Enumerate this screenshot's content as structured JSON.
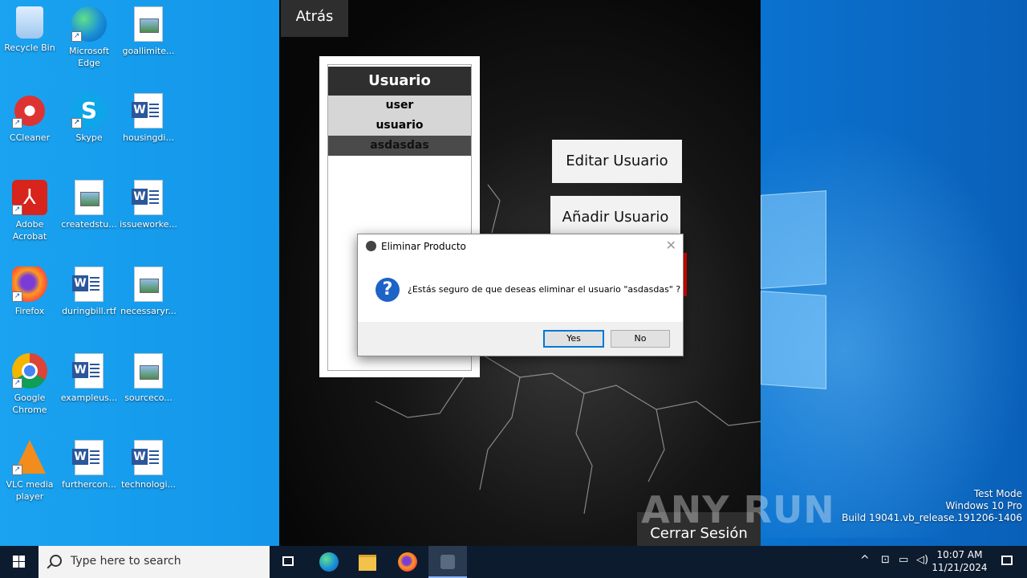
{
  "desktop": {
    "icons": [
      {
        "label": "Recycle Bin"
      },
      {
        "label": "Microsoft Edge"
      },
      {
        "label": "goallimite..."
      },
      {
        "label": "CCleaner"
      },
      {
        "label": "Skype"
      },
      {
        "label": "housingdi..."
      },
      {
        "label": "Adobe Acrobat"
      },
      {
        "label": "createdstu..."
      },
      {
        "label": "issueworke..."
      },
      {
        "label": "Firefox"
      },
      {
        "label": "duringbill.rtf"
      },
      {
        "label": "necessaryr..."
      },
      {
        "label": "Google Chrome"
      },
      {
        "label": "exampleus..."
      },
      {
        "label": "sourceco..."
      },
      {
        "label": "VLC media player"
      },
      {
        "label": "furthercon..."
      },
      {
        "label": "technologi..."
      }
    ]
  },
  "app": {
    "back_label": "Atrás",
    "list_header": "Usuario",
    "users": [
      "user",
      "usuario",
      "asdasdas"
    ],
    "edit_label": "Editar Usuario",
    "add_label": "Añadir Usuario",
    "logout_label": "Cerrar Sesión"
  },
  "dialog": {
    "title": "Eliminar Producto",
    "message": "¿Estás seguro de que deseas eliminar el usuario \"asdasdas\" ?",
    "yes_label": "Yes",
    "no_label": "No"
  },
  "watermark": {
    "brand": "ANY RUN",
    "line1": "Test Mode",
    "line2": "Windows 10 Pro",
    "line3": "Build 19041.vb_release.191206-1406"
  },
  "taskbar": {
    "search_placeholder": "Type here to search",
    "time": "10:07 AM",
    "date": "11/21/2024"
  }
}
